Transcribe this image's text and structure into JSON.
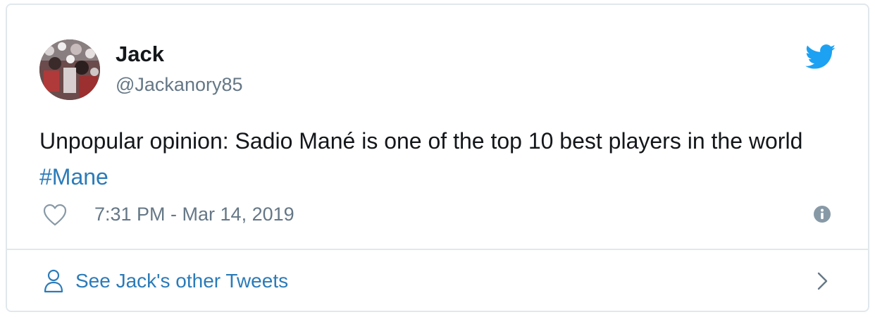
{
  "tweet": {
    "display_name": "Jack",
    "handle": "@Jackanory85",
    "text_main": "Unpopular opinion: Sadio Mané is one of the top 10 best players in the world ",
    "hashtag": "#Mane",
    "timestamp": "7:31 PM - Mar 14, 2019"
  },
  "footer": {
    "see_more_label": "See Jack's other Tweets"
  },
  "icons": {
    "brand": "twitter-bird-icon",
    "like": "heart-icon",
    "info": "info-icon",
    "profile": "person-icon",
    "more": "chevron-right-icon"
  },
  "colors": {
    "twitter_blue": "#1da1f2",
    "link_blue": "#2b7bb9",
    "text_primary": "#14171a",
    "text_secondary": "#657786",
    "border": "#e1e8ed"
  }
}
